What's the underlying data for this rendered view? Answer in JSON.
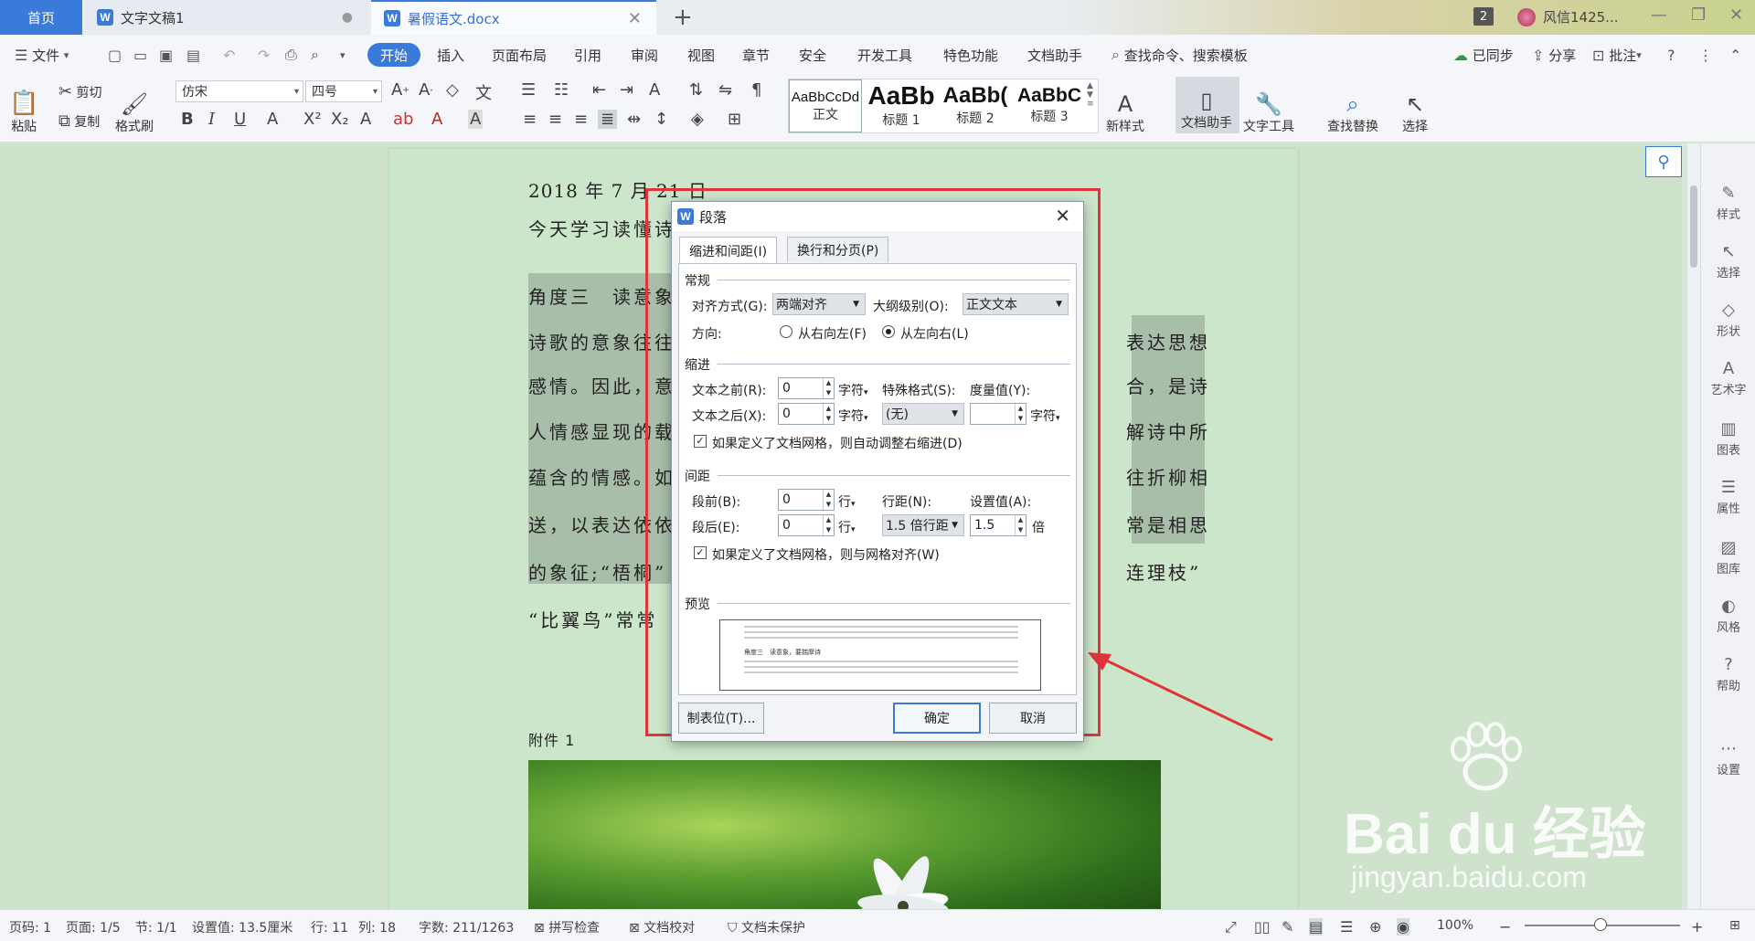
{
  "titlebar": {
    "tabs": [
      {
        "label": "首页"
      },
      {
        "label": "文字文稿1"
      },
      {
        "label": "暑假语文.docx"
      }
    ],
    "notification_count": "2",
    "user_name": "风信1425..."
  },
  "menubar": {
    "file_label": "文件",
    "items": [
      "开始",
      "插入",
      "页面布局",
      "引用",
      "审阅",
      "视图",
      "章节",
      "安全",
      "开发工具",
      "特色功能",
      "文档助手"
    ],
    "search_label": "查找命令、搜索模板",
    "synced_label": "已同步",
    "share_label": "分享",
    "comment_label": "批注"
  },
  "ribbon": {
    "paste_label": "粘贴",
    "cut_label": "剪切",
    "copy_label": "复制",
    "format_painter_label": "格式刷",
    "font_name": "仿宋",
    "font_size": "四号",
    "styles": [
      {
        "sample": "AaBbCcDd",
        "name": "正文"
      },
      {
        "sample": "AaBb",
        "name": "标题 1"
      },
      {
        "sample": "AaBb(",
        "name": "标题 2"
      },
      {
        "sample": "AaBbC",
        "name": "标题 3"
      }
    ],
    "new_style_label": "新样式",
    "doc_assistant_label": "文档助手",
    "text_tools_label": "文字工具",
    "find_replace_label": "查找替换",
    "select_label": "选择"
  },
  "document": {
    "date_line": "2018 年 7 月 21 日",
    "line2": "今天学习读懂诗",
    "para_lines": [
      "角度三　读意象",
      "诗歌的意象往往",
      "感情。因此，意",
      "人情感显现的载",
      "蕴含的情感。如",
      "送，以表达依依",
      "的象征;“梧桐”",
      "“比翼鸟”常常"
    ],
    "para_lines_right": [
      "",
      "表达思想",
      "合，是诗",
      "解诗中所",
      "往折柳相",
      "常是相思",
      "连理枝”",
      ""
    ],
    "attachment_label": "附件 1"
  },
  "side_panel": {
    "items": [
      "样式",
      "选择",
      "形状",
      "艺术字",
      "图表",
      "属性",
      "图库",
      "风格",
      "帮助",
      "设置"
    ]
  },
  "statusbar": {
    "page_code": "页码: 1",
    "page": "页面: 1/5",
    "section": "节: 1/1",
    "setting": "设置值: 13.5厘米",
    "row": "行: 11",
    "col": "列: 18",
    "word_count": "字数: 211/1263",
    "spell_check": "拼写检查",
    "doc_proof": "文档校对",
    "protect": "文档未保护",
    "zoom": "100%"
  },
  "dialog": {
    "title": "段落",
    "tabs": [
      "缩进和间距(I)",
      "换行和分页(P)"
    ],
    "general": {
      "section": "常规",
      "alignment_label": "对齐方式(G):",
      "alignment_value": "两端对齐",
      "outline_label": "大纲级别(O):",
      "outline_value": "正文文本",
      "direction_label": "方向:",
      "rtl_label": "从右向左(F)",
      "ltr_label": "从左向右(L)"
    },
    "indent": {
      "section": "缩进",
      "before_label": "文本之前(R):",
      "before_value": "0",
      "after_label": "文本之后(X):",
      "after_value": "0",
      "unit": "字符",
      "special_label": "特殊格式(S):",
      "special_value": "(无)",
      "measure_label": "度量值(Y):",
      "measure_value": "",
      "auto_adjust_label": "如果定义了文档网格，则自动调整右缩进(D)"
    },
    "spacing": {
      "section": "间距",
      "before_label": "段前(B):",
      "before_value": "0",
      "after_label": "段后(E):",
      "after_value": "0",
      "unit": "行",
      "line_spacing_label": "行距(N):",
      "line_spacing_value": "1.5 倍行距",
      "setting_label": "设置值(A):",
      "setting_value": "1.5",
      "setting_unit": "倍",
      "grid_label": "如果定义了文档网格，则与网格对齐(W)"
    },
    "preview": {
      "section": "预览",
      "sample_text": "角度三　读意象，要揣摩诗"
    },
    "tabstops_button": "制表位(T)...",
    "ok_button": "确定",
    "cancel_button": "取消"
  },
  "watermark": {
    "logo": "Bai du 经验",
    "url": "jingyan.baidu.com"
  },
  "colors": {
    "accent": "#3a7ad8",
    "highlight_frame": "#e0343a",
    "doc_background": "#cce6cc"
  }
}
